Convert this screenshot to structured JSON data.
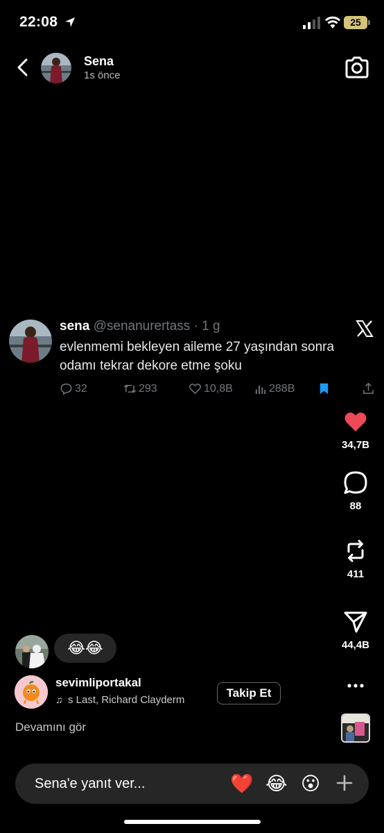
{
  "status_bar": {
    "time": "22:08",
    "battery": "25"
  },
  "header": {
    "name": "Sena",
    "time_ago": "1s önce"
  },
  "tweet": {
    "name": "sena",
    "handle_time": "@senanurertass · 1 g",
    "text": "evlenmemi bekleyen aileme 27 yaşından sonra odamı tekrar dekore etme şoku",
    "replies": "32",
    "retweets": "293",
    "likes": "10,8B",
    "views": "288B"
  },
  "rail": {
    "likes": "34,7B",
    "comments": "88",
    "reposts": "411",
    "shares": "44,4B",
    "accent_like": "#ed4956"
  },
  "reaction": {
    "emojis": "😂😂"
  },
  "music": {
    "username": "sevimliportakal",
    "track": "s Last, Richard Clayderm",
    "follow_label": "Takip Et",
    "see_more": "Devamını gör"
  },
  "reply": {
    "placeholder": "Sena'e yanıt ver...",
    "quick_reactions": [
      "❤️",
      "😂",
      "😮"
    ]
  }
}
